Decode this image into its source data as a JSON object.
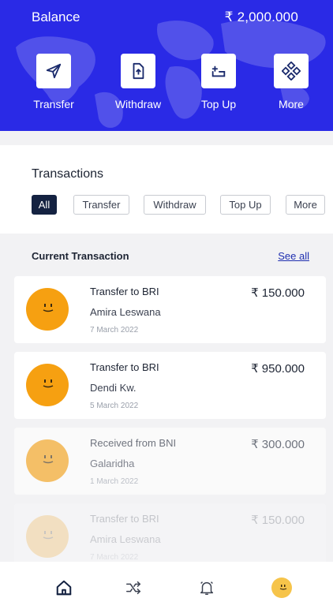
{
  "balance": {
    "label": "Balance",
    "value": "₹ 2,000.000"
  },
  "actions": [
    {
      "label": "Transfer",
      "icon": "send-icon"
    },
    {
      "label": "Withdraw",
      "icon": "withdraw-icon"
    },
    {
      "label": "Top Up",
      "icon": "top-up-icon"
    },
    {
      "label": "More",
      "icon": "more-grid-icon"
    }
  ],
  "transactions": {
    "title": "Transactions",
    "filters": [
      "All",
      "Transfer",
      "Withdraw",
      "Top Up",
      "More"
    ],
    "active_filter": "All"
  },
  "current": {
    "title": "Current Transaction",
    "see_all": "See all",
    "items": [
      {
        "title": "Transfer to BRI",
        "name": "Amira Leswana",
        "date": "7 March 2022",
        "amount": "₹ 150.000"
      },
      {
        "title": "Transfer to BRI",
        "name": "Dendi Kw.",
        "date": "5 March 2022",
        "amount": "₹ 950.000"
      },
      {
        "title": "Received from BNI",
        "name": "Galaridha",
        "date": "1 March 2022",
        "amount": "₹ 300.000"
      },
      {
        "title": "Transfer to BRI",
        "name": "Amira Leswana",
        "date": "7 March 2022",
        "amount": "₹ 150.000"
      }
    ]
  },
  "nav": [
    {
      "icon": "home-icon",
      "active": true
    },
    {
      "icon": "shuffle-icon"
    },
    {
      "icon": "bell-icon"
    },
    {
      "icon": "profile-avatar-icon"
    }
  ],
  "colors": {
    "brand": "#2a2ae6",
    "avatar": "#f6a011",
    "dark": "#142241"
  }
}
